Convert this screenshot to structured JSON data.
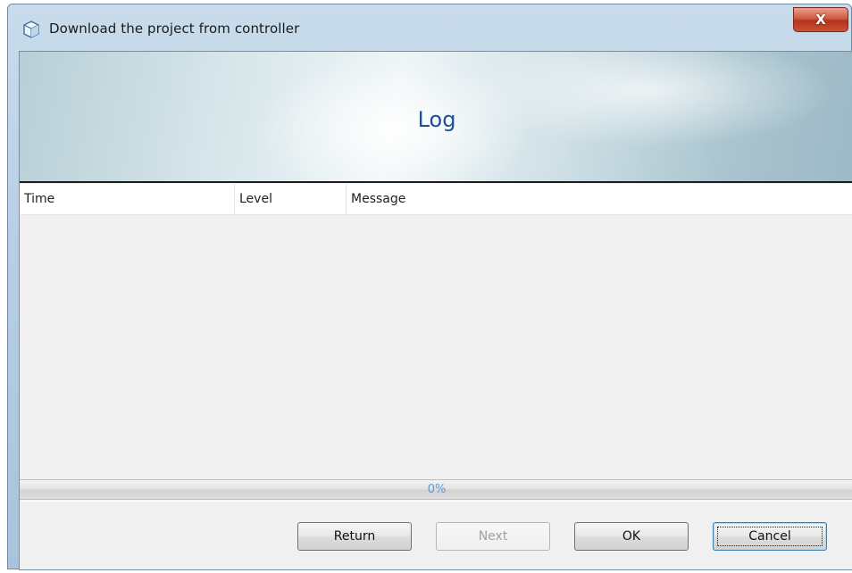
{
  "window": {
    "title": "Download the project from controller",
    "close_label": "X",
    "title_icon": "cube-icon"
  },
  "banner": {
    "title": "Log"
  },
  "log_table": {
    "columns": [
      "Time",
      "Level",
      "Message"
    ],
    "rows": []
  },
  "progress": {
    "value": 0,
    "label": "0%"
  },
  "buttons": {
    "return": "Return",
    "next": "Next",
    "ok": "OK",
    "cancel": "Cancel"
  },
  "colors": {
    "banner_title": "#1f4e96",
    "progress_text": "#5a96db",
    "close_button": "#c4533a"
  }
}
